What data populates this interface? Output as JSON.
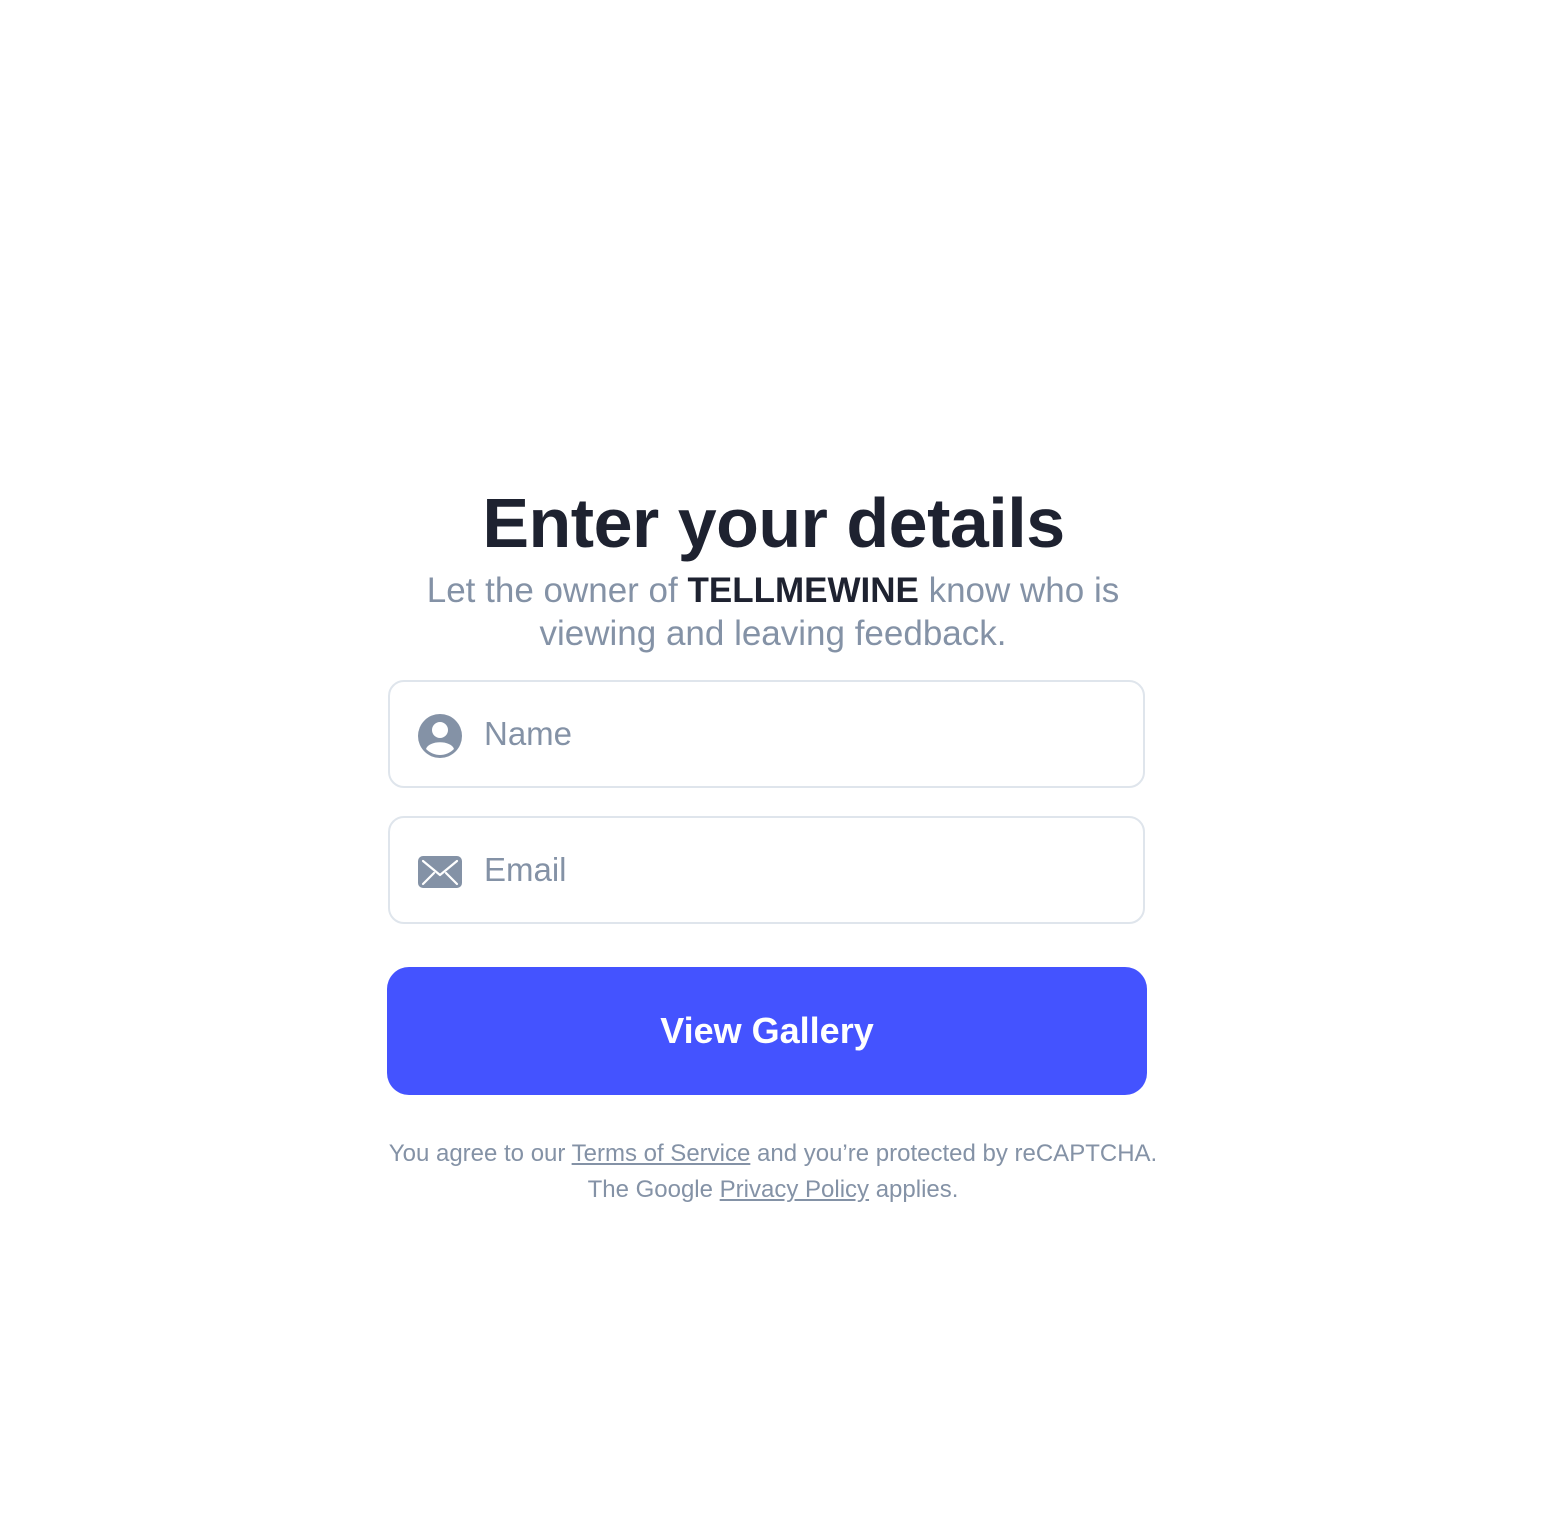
{
  "heading": "Enter your details",
  "subtitle": {
    "before": "Let the owner of ",
    "brand": "TELLMEWINE",
    "after": " know who is viewing and leaving feedback."
  },
  "form": {
    "name_placeholder": "Name",
    "name_value": "",
    "email_placeholder": "Email",
    "email_value": "",
    "submit_label": "View Gallery"
  },
  "legal": {
    "part1": "You agree to our ",
    "terms_link": "Terms of Service",
    "part2": " and you’re protected by reCAPTCHA. The Google ",
    "privacy_link": "Privacy Policy",
    "part3": " applies."
  },
  "icons": {
    "name_field": "user-circle-icon",
    "email_field": "envelope-icon"
  },
  "colors": {
    "accent": "#4453ff",
    "heading": "#1e2230",
    "muted": "#8492a6",
    "border": "#dfe5ec"
  }
}
